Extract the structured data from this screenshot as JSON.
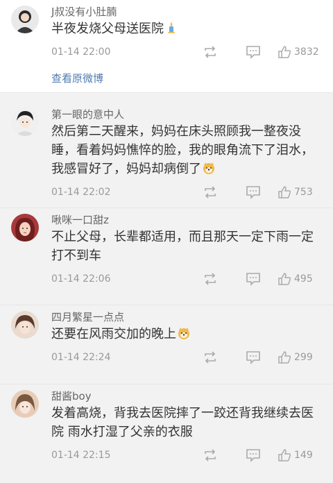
{
  "comments": [
    {
      "user": "J叔没有小肚腩",
      "text": "半夜发烧父母送医院",
      "emoji": "candle-emoji",
      "time": "01-14 22:00",
      "likes": "3832",
      "link": "查看原微博",
      "avatar_color": "#2b2b2b"
    },
    {
      "user": "第一眼的意中人",
      "text": "然后第二天醒来，妈妈在床头照顾我一整夜没睡，看着妈妈憔悴的脸，我的眼角流下了泪水，我感冒好了，妈妈却病倒了",
      "emoji": "doge-emoji",
      "time": "01-14 22:02",
      "likes": "753",
      "avatar_color": "#d8d8d8"
    },
    {
      "user": "啾咪一口甜z",
      "text": "不止父母，长辈都适用，而且那天一定下雨一定打不到车",
      "emoji": "",
      "time": "01-14 22:06",
      "likes": "495",
      "avatar_color": "#a8393a"
    },
    {
      "user": "四月繁星一点点",
      "text": "还要在风雨交加的晚上",
      "emoji": "doge-emoji",
      "time": "01-14 22:24",
      "likes": "299",
      "avatar_color": "#c9a07f"
    },
    {
      "user": "甜酱boy",
      "text": "发着高烧，背我去医院摔了一跤还背我继续去医院 雨水打湿了父亲的衣服",
      "emoji": "",
      "time": "01-14 22:15",
      "likes": "149",
      "avatar_color": "#e7cdb9"
    }
  ],
  "colors": {
    "background": "#f2f2f2",
    "link": "#4f7cae",
    "meta": "#999999",
    "text": "#333333"
  }
}
